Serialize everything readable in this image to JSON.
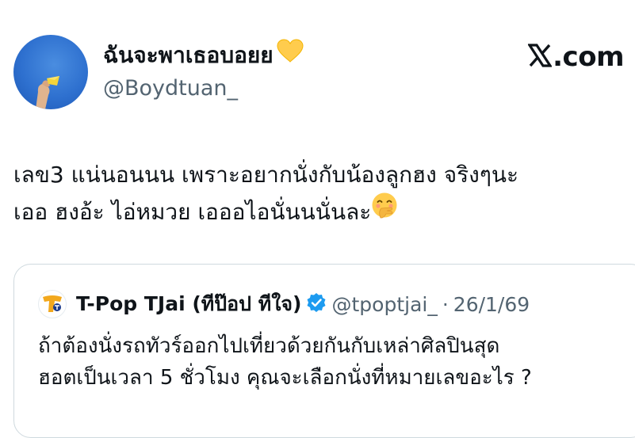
{
  "post": {
    "author": {
      "display_name": "ฉันจะพาเธอบอยย",
      "name_emoji": "yellow-heart",
      "handle": "@Boydtuan_"
    },
    "brand": {
      "text": ".com",
      "logo": "x-logo"
    },
    "text_lines": [
      "เลข3 แน่นอนนน เพราะอยากนั่งกับน้องลูกฮง จริงๆนะ",
      "เออ ฮงอ้ะ ไอ่หมวย เอออไอนั่นนนั่นละ"
    ],
    "text_emoji": "hand-over-mouth-face"
  },
  "quote": {
    "author": {
      "display_name": "T-Pop TJai (ทีป๊อป ทีใจ)",
      "verified": true,
      "handle": "@tpoptjai_",
      "separator": "·",
      "date": "26/1/69"
    },
    "text_lines": [
      "ถ้าต้องนั่งรถทัวร์ออกไปเที่ยวด้วยกันกับเหล่าศิลปินสุด",
      "ฮอตเป็นเวลา 5 ชั่วโมง คุณจะเลือกนั่งที่หมายเลขอะไร ?"
    ]
  },
  "colors": {
    "text_primary": "#0f1419",
    "text_secondary": "#536471",
    "border": "#cfd9de",
    "verified_blue": "#1d9bf0",
    "avatar_blue": "#2e70cf",
    "heart_yellow": "#ffcc4d"
  }
}
